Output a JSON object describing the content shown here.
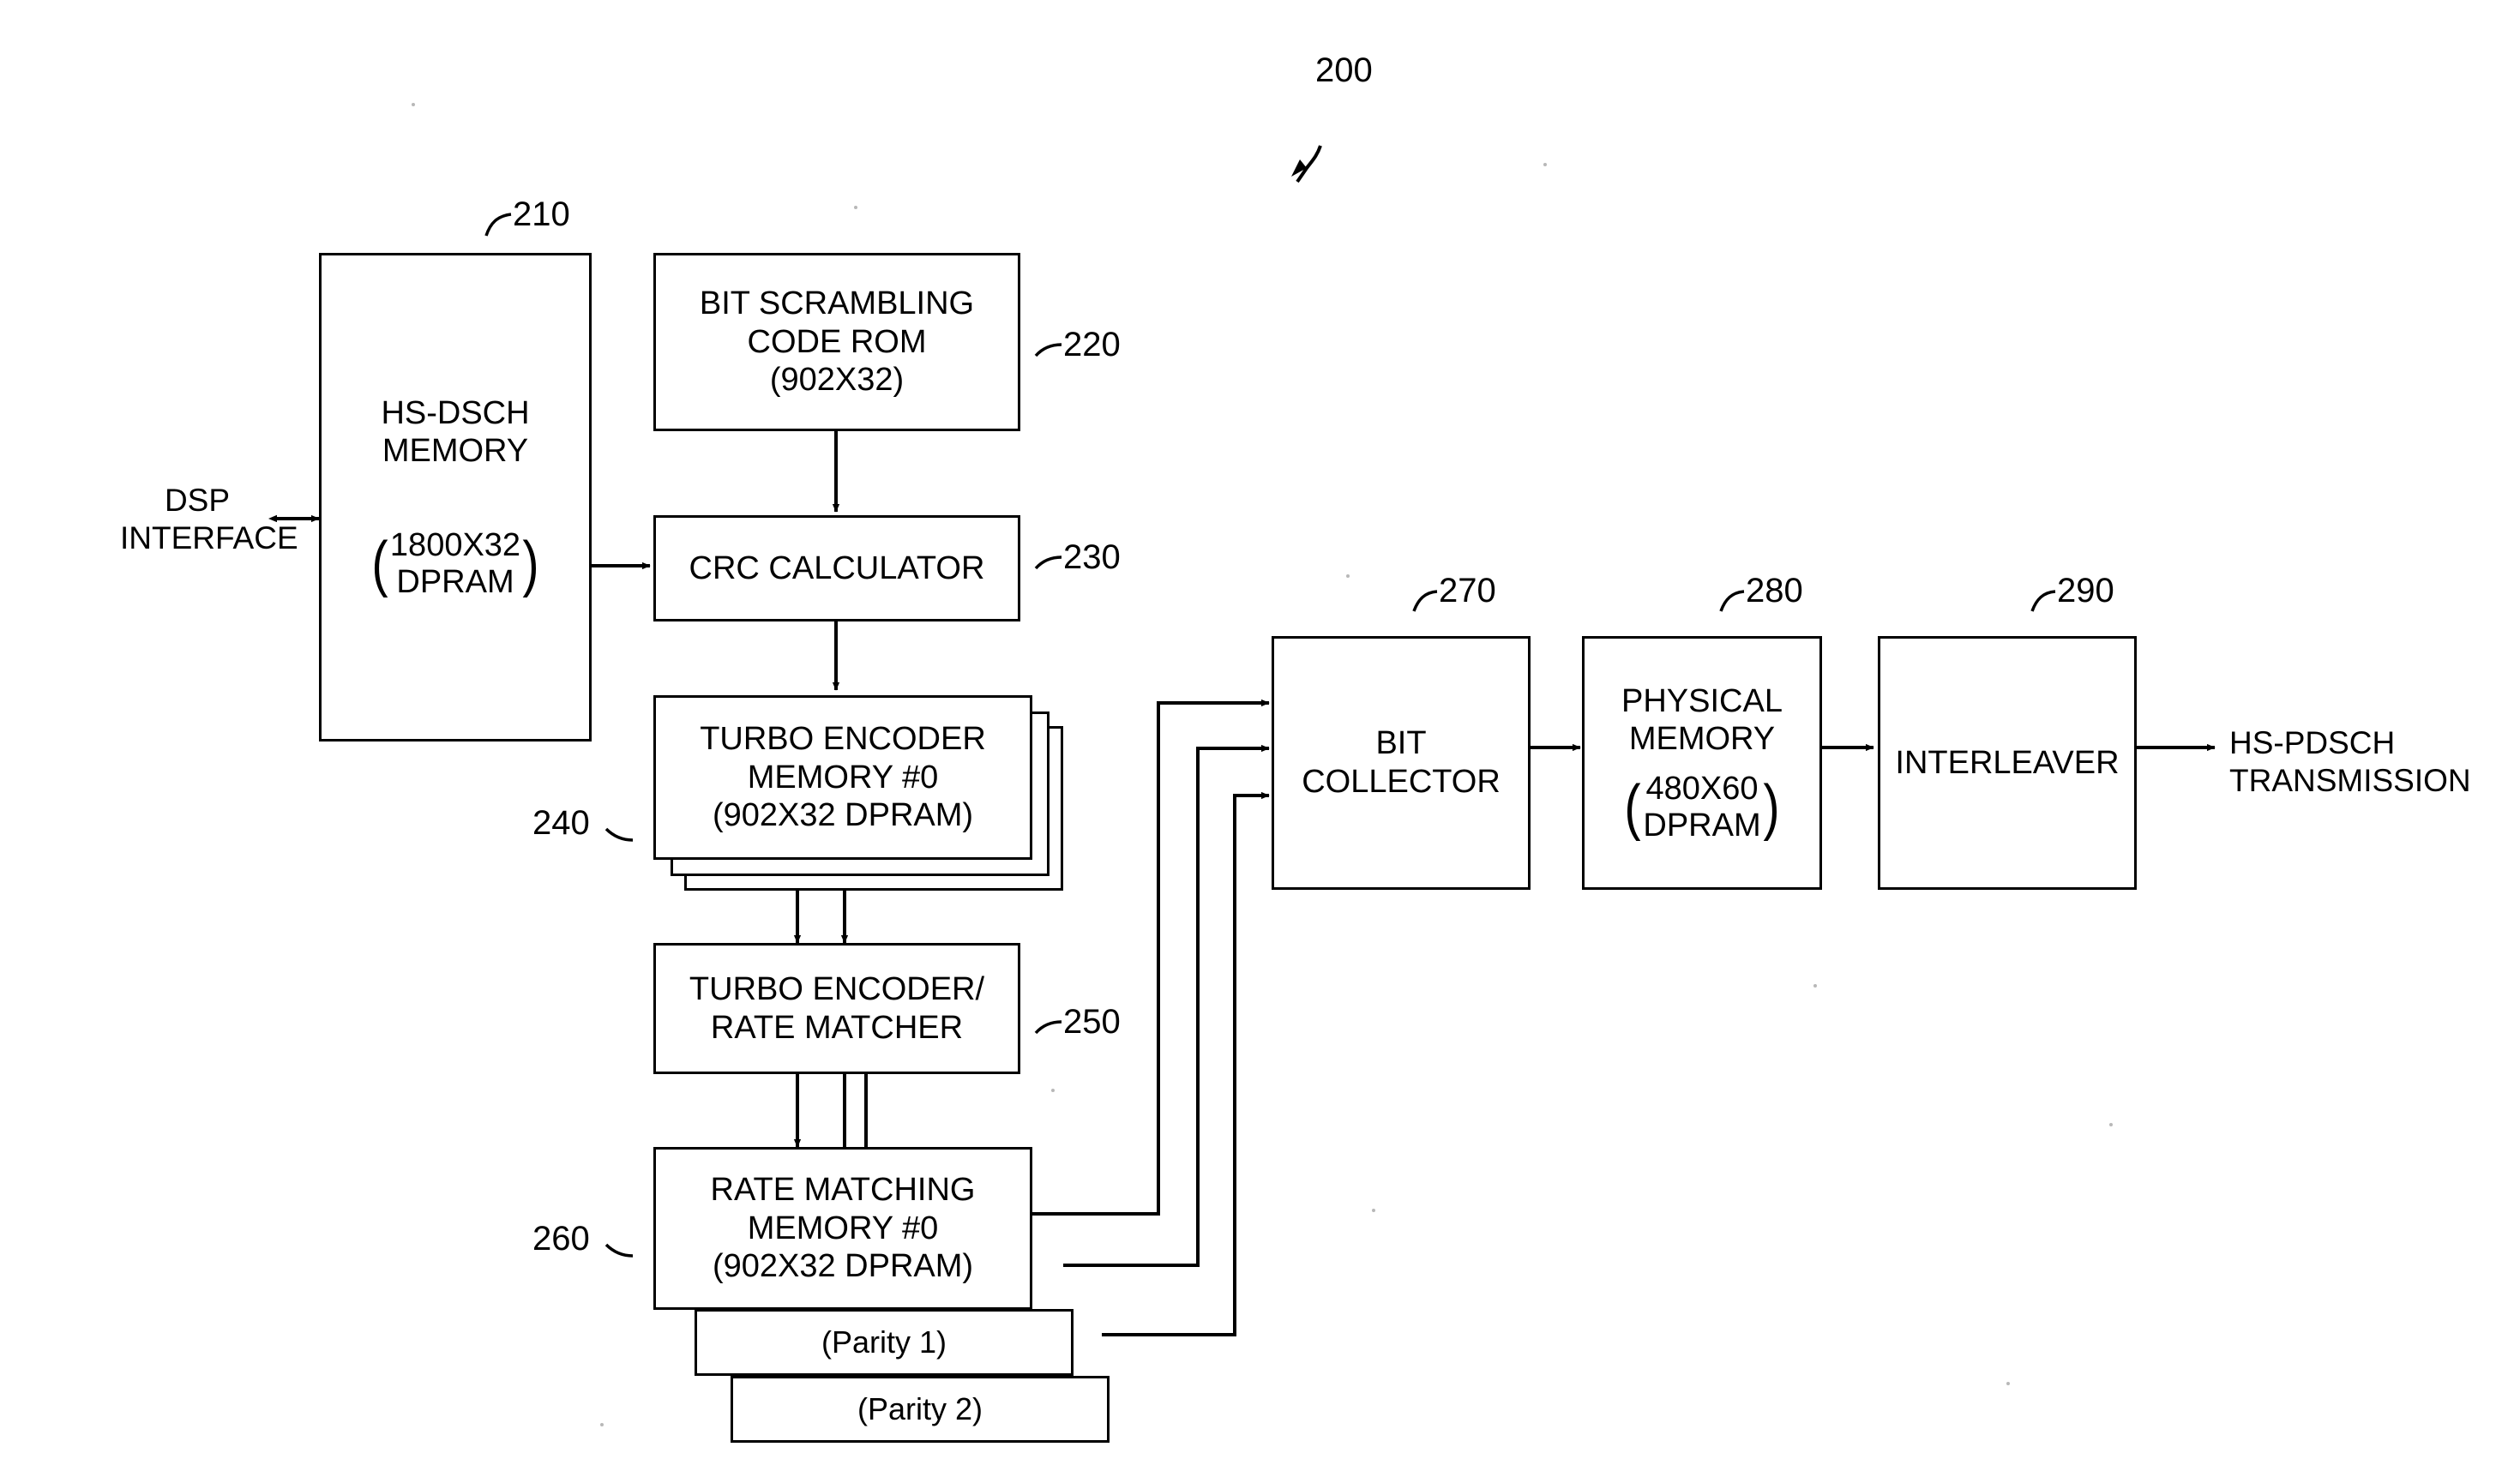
{
  "figure": {
    "number": "200"
  },
  "blocks": {
    "hs_dsch_memory": {
      "ref": "210",
      "line1": "HS-DSCH",
      "line2": "MEMORY",
      "spec_line1": "1800X32",
      "spec_line2": "DPRAM"
    },
    "bit_scrambling_rom": {
      "ref": "220",
      "line1": "BIT SCRAMBLING",
      "line2": "CODE ROM",
      "line3": "(902X32)"
    },
    "crc_calculator": {
      "ref": "230",
      "line1": "CRC CALCULATOR"
    },
    "turbo_encoder_memory": {
      "ref": "240",
      "line1": "TURBO ENCODER",
      "line2": "MEMORY #0",
      "line3": "(902X32 DPRAM)"
    },
    "turbo_encoder_rate_matcher": {
      "ref": "250",
      "line1": "TURBO ENCODER/",
      "line2": "RATE MATCHER"
    },
    "rate_matching_memory": {
      "ref": "260",
      "line1": "RATE MATCHING",
      "line2": "MEMORY #0",
      "line3": "(902X32 DPRAM)",
      "parity1": "(Parity 1)",
      "parity2": "(Parity 2)"
    },
    "bit_collector": {
      "ref": "270",
      "line1": "BIT",
      "line2": "COLLECTOR"
    },
    "physical_memory": {
      "ref": "280",
      "line1": "PHYSICAL",
      "line2": "MEMORY",
      "spec_line1": "480X60",
      "spec_line2": "DPRAM"
    },
    "interleaver": {
      "ref": "290",
      "line1": "INTERLEAVER"
    }
  },
  "labels": {
    "dsp_interface_line1": "DSP",
    "dsp_interface_line2": "INTERFACE",
    "output_line1": "HS-PDSCH",
    "output_line2": "TRANSMISSION"
  }
}
